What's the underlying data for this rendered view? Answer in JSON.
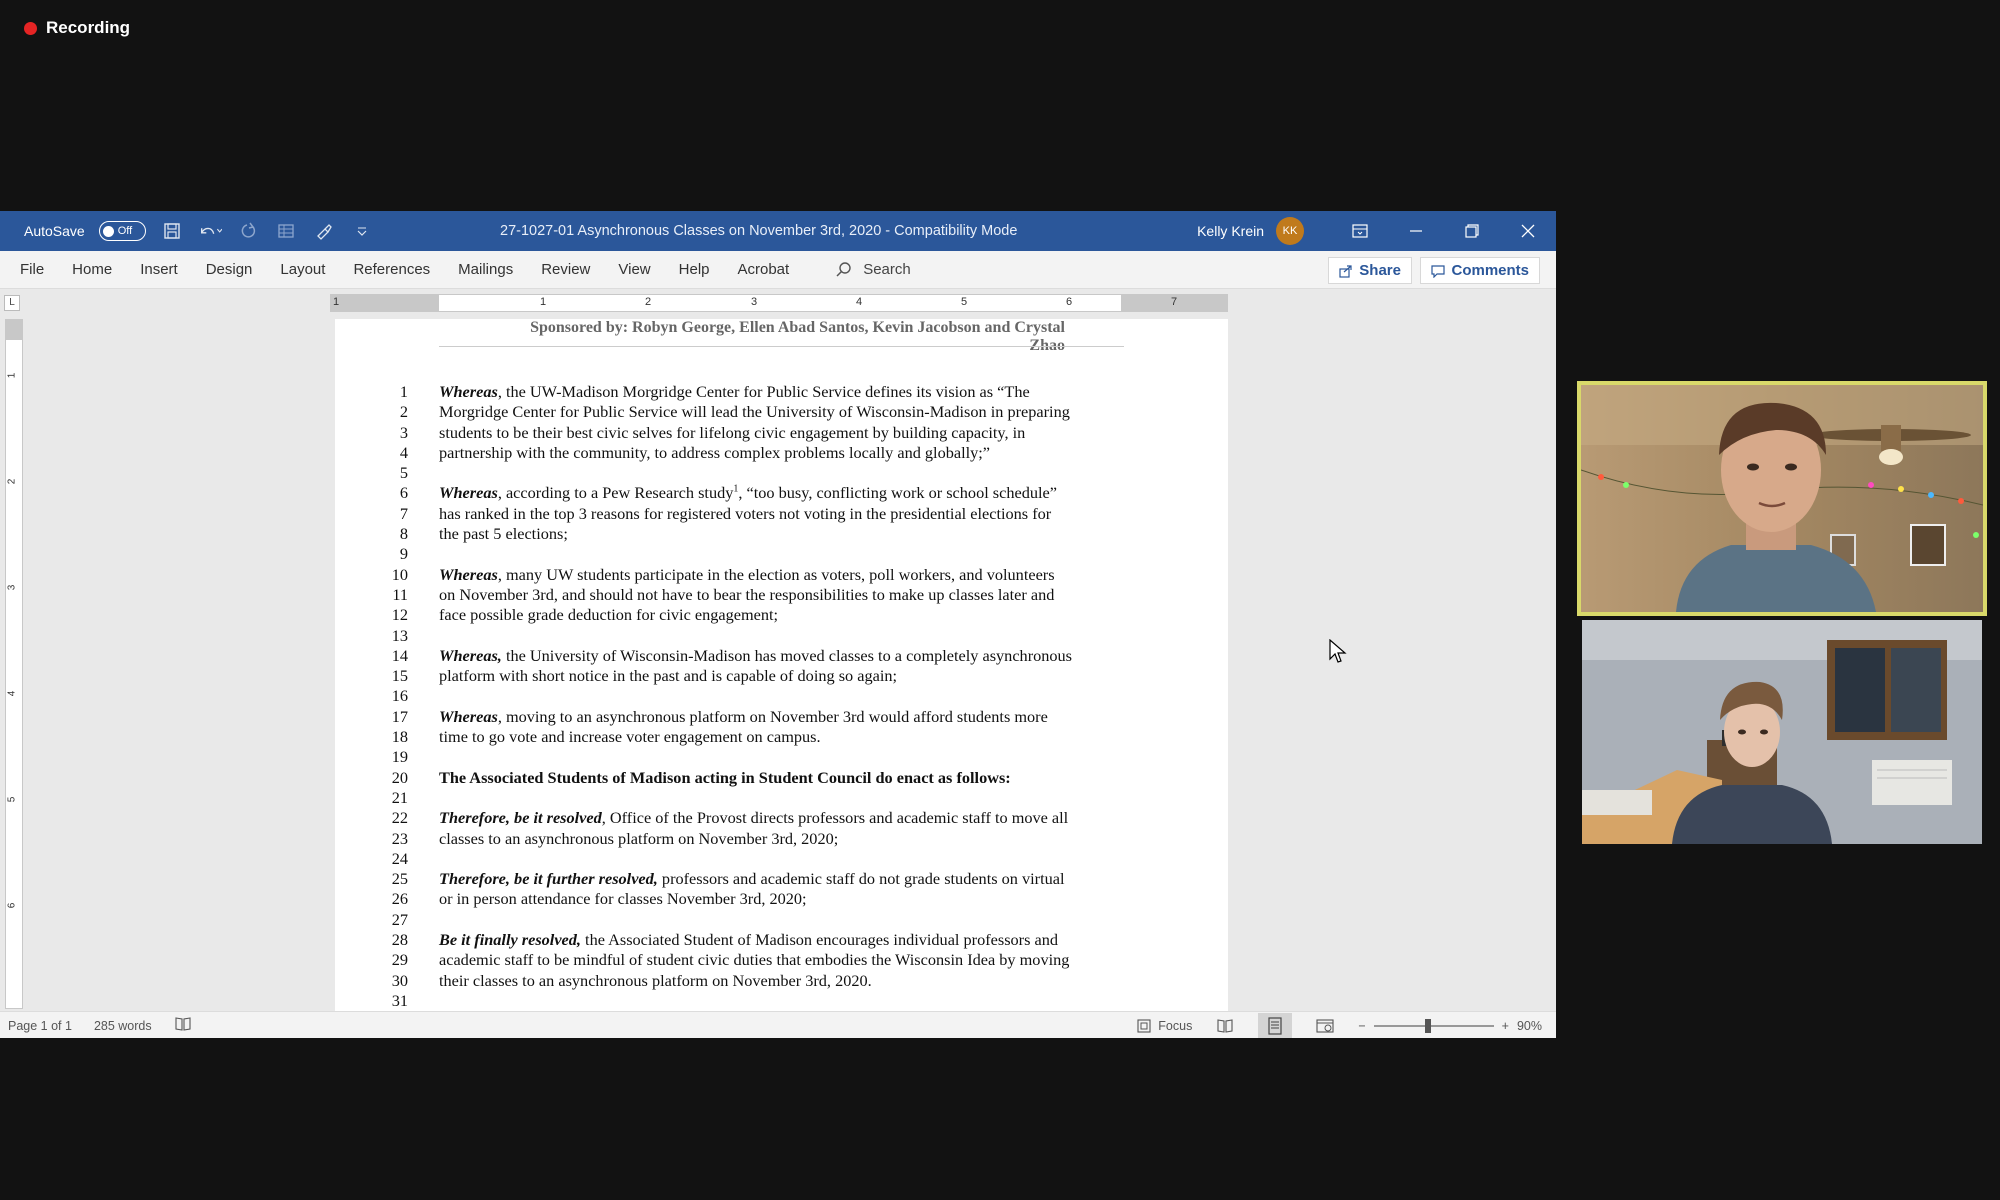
{
  "recording": {
    "label": "Recording"
  },
  "titlebar": {
    "autosave_label": "AutoSave",
    "autosave_state": "Off",
    "doc_title": "27-1027-01 Asynchronous Classes on November 3rd, 2020  -  Compatibility Mode",
    "user_name": "Kelly Krein",
    "user_initials": "KK",
    "accent": "#2b579a"
  },
  "menu": {
    "items": [
      "File",
      "Home",
      "Insert",
      "Design",
      "Layout",
      "References",
      "Mailings",
      "Review",
      "View",
      "Help",
      "Acrobat"
    ],
    "search_label": "Search",
    "share_label": "Share",
    "comments_label": "Comments"
  },
  "ruler": {
    "h_numbers": [
      "1",
      "1",
      "2",
      "3",
      "4",
      "5",
      "6",
      "7"
    ],
    "v_numbers": [
      "1",
      "2",
      "3",
      "4",
      "5",
      "6"
    ]
  },
  "document": {
    "sponsor": "Sponsored by: Robyn George, Ellen Abad Santos, Kevin Jacobson and Crystal Zhao",
    "lines": [
      {
        "n": "1",
        "lead": "Whereas",
        "lead_style": "bi",
        "text": ", the UW-Madison Morgridge Center for Public Service defines its vision as “The"
      },
      {
        "n": "2",
        "lead": "",
        "lead_style": "",
        "text": "Morgridge Center for Public Service will lead the University of Wisconsin-Madison in preparing"
      },
      {
        "n": "3",
        "lead": "",
        "lead_style": "",
        "text": "students to be their best civic selves for lifelong civic engagement by building capacity, in"
      },
      {
        "n": "4",
        "lead": "",
        "lead_style": "",
        "text": "partnership with the community, to address complex problems locally and globally;”"
      },
      {
        "n": "5",
        "lead": "",
        "lead_style": "",
        "text": ""
      },
      {
        "n": "6",
        "lead": "Whereas",
        "lead_style": "bi",
        "text": ", according to a Pew Research study",
        "sup": "1",
        "after": ", “too busy, conflicting work or school schedule”"
      },
      {
        "n": "7",
        "lead": "",
        "lead_style": "",
        "text": "has ranked in the top 3 reasons for registered voters not voting in the presidential elections for"
      },
      {
        "n": "8",
        "lead": "",
        "lead_style": "",
        "text": "the past 5 elections;"
      },
      {
        "n": "9",
        "lead": "",
        "lead_style": "",
        "text": ""
      },
      {
        "n": "10",
        "lead": "Whereas",
        "lead_style": "bi",
        "text": ", many UW students participate in the election as voters, poll workers, and volunteers"
      },
      {
        "n": "11",
        "lead": "",
        "lead_style": "",
        "text": "on November 3rd, and should not have to bear the responsibilities to make up classes later and"
      },
      {
        "n": "12",
        "lead": "",
        "lead_style": "",
        "text": "face possible grade deduction for civic engagement;"
      },
      {
        "n": "13",
        "lead": "",
        "lead_style": "",
        "text": ""
      },
      {
        "n": "14",
        "lead": "Whereas,",
        "lead_style": "bi",
        "text": " the University of Wisconsin-Madison has moved classes to a completely asynchronous"
      },
      {
        "n": "15",
        "lead": "",
        "lead_style": "",
        "text": "platform with short notice in the past and is capable of doing so again;"
      },
      {
        "n": "16",
        "lead": "",
        "lead_style": "",
        "text": ""
      },
      {
        "n": "17",
        "lead": "Whereas",
        "lead_style": "bi",
        "text": ", moving to an asynchronous platform on November 3rd would afford students more"
      },
      {
        "n": "18",
        "lead": "",
        "lead_style": "",
        "text": "time to go vote and increase voter engagement on campus."
      },
      {
        "n": "19",
        "lead": "",
        "lead_style": "",
        "text": ""
      },
      {
        "n": "20",
        "lead": "The Associated Students of Madison acting in Student Council do enact as follows:",
        "lead_style": "bo",
        "text": ""
      },
      {
        "n": "21",
        "lead": "",
        "lead_style": "",
        "text": ""
      },
      {
        "n": "22",
        "lead": "Therefore, be it resolved",
        "lead_style": "bi",
        "text": ", Office of the Provost directs professors and academic staff to move all"
      },
      {
        "n": "23",
        "lead": "",
        "lead_style": "",
        "text": "classes to an asynchronous platform on November 3rd, 2020;"
      },
      {
        "n": "24",
        "lead": "",
        "lead_style": "",
        "text": ""
      },
      {
        "n": "25",
        "lead": "Therefore, be it further resolved,",
        "lead_style": "bi",
        "text": " professors and academic staff do not grade students on virtual"
      },
      {
        "n": "26",
        "lead": "",
        "lead_style": "",
        "text": "or in person attendance for classes November 3rd, 2020;"
      },
      {
        "n": "27",
        "lead": "",
        "lead_style": "",
        "text": ""
      },
      {
        "n": "28",
        "lead": "Be it finally resolved,",
        "lead_style": "bi",
        "text": " the Associated Student of Madison encourages individual professors and"
      },
      {
        "n": "29",
        "lead": "",
        "lead_style": "",
        "text": "academic staff to be mindful of student civic duties that embodies the Wisconsin Idea by moving"
      },
      {
        "n": "30",
        "lead": "",
        "lead_style": "",
        "text": "their classes to an asynchronous platform on November 3rd, 2020."
      },
      {
        "n": "31",
        "lead": "",
        "lead_style": "",
        "text": ""
      }
    ]
  },
  "statusbar": {
    "page": "Page 1 of 1",
    "words": "285 words",
    "focus": "Focus",
    "zoom_minus": "−",
    "zoom_plus": "+",
    "zoom": "90%",
    "zoom_fraction": 0.45
  }
}
